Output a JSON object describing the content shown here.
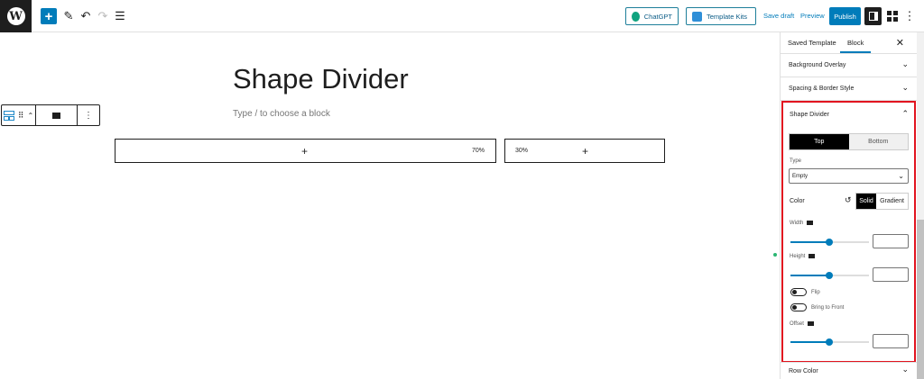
{
  "toolbar": {
    "add_icon": "+",
    "pencil_icon": "✎",
    "undo_icon": "↶",
    "redo_icon": "↷",
    "list_icon": "☰",
    "chatgpt_label": "ChatGPT",
    "template_kits_label": "Template Kits",
    "save_draft_label": "Save draft",
    "preview_label": "Preview",
    "publish_label": "Publish",
    "more_icon": "⋮"
  },
  "editor": {
    "title": "Shape Divider",
    "placeholder": "Type / to choose a block",
    "columns": [
      {
        "plus": "+",
        "percent": "70%"
      },
      {
        "plus": "+",
        "percent": "30%"
      }
    ],
    "block_toolbar": {
      "drag_icon": "⠿",
      "updown_icon": "⌃",
      "more_icon": "⋮"
    }
  },
  "sidebar": {
    "tab_saved": "Saved Template",
    "tab_block": "Block",
    "close_icon": "✕",
    "panels": [
      {
        "label": "Background Overlay",
        "chev": "⌄"
      },
      {
        "label": "Spacing & Border Style",
        "chev": "⌄"
      }
    ],
    "shape_divider": {
      "title": "Shape Divider",
      "chev": "⌃",
      "tab_top": "Top",
      "tab_bottom": "Bottom",
      "type_label": "Type",
      "type_value": "Empty",
      "color_label": "Color",
      "reset_icon": "↺",
      "solid_label": "Solid",
      "gradient_label": "Gradient",
      "width_label": "Width",
      "height_label": "Height",
      "flip_label": "Flip",
      "bring_front_label": "Bring to Front",
      "offset_label": "Offset",
      "width_level": 0.5,
      "height_level": 0.5,
      "offset_level": 0.5
    },
    "row_color_label": "Row Color",
    "row_color_chev": "⌄"
  },
  "colors": {
    "accent": "#007cba",
    "highlight": "#e1141f",
    "chatgpt_icon": "#10a37f"
  }
}
